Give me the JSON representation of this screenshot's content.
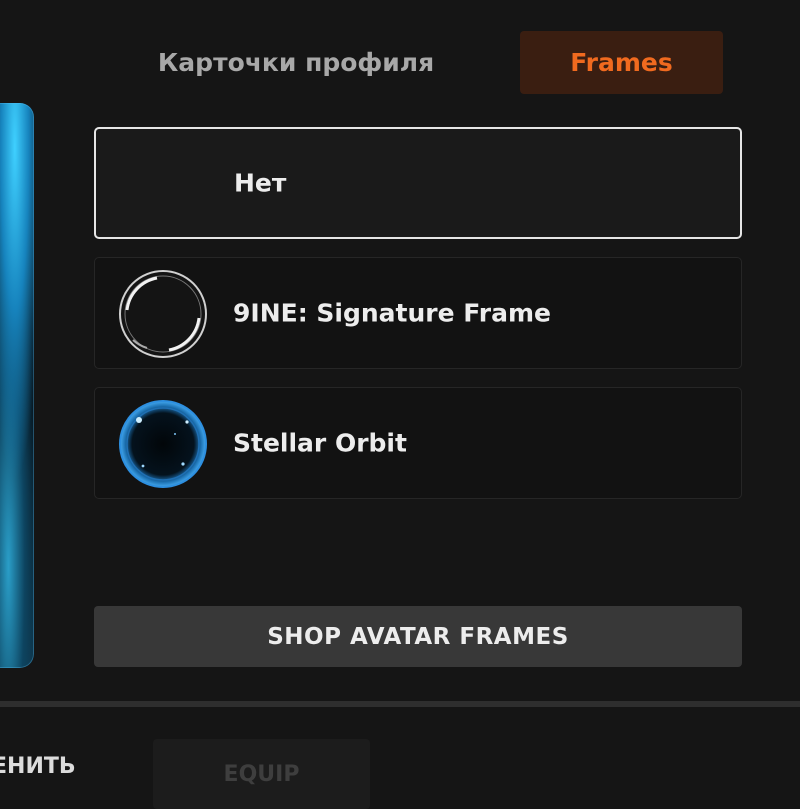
{
  "tabs": {
    "profile_cards": "Карточки профиля",
    "frames": "Frames",
    "active": "Frames"
  },
  "options": [
    {
      "label": "Нет",
      "selected": true,
      "icon": null
    },
    {
      "label": "9INE: Signature Frame",
      "selected": false,
      "icon": "signature-frame-icon"
    },
    {
      "label": "Stellar Orbit",
      "selected": false,
      "icon": "stellar-orbit-icon"
    }
  ],
  "shop_button": "SHOP AVATAR FRAMES",
  "footer": {
    "apply_label": "ЕНИТЬ",
    "equip_label": "EQUIP",
    "equip_enabled": false
  },
  "colors": {
    "accent": "#f06a1f",
    "accent_bg": "#3a1e11",
    "background": "#151515"
  }
}
